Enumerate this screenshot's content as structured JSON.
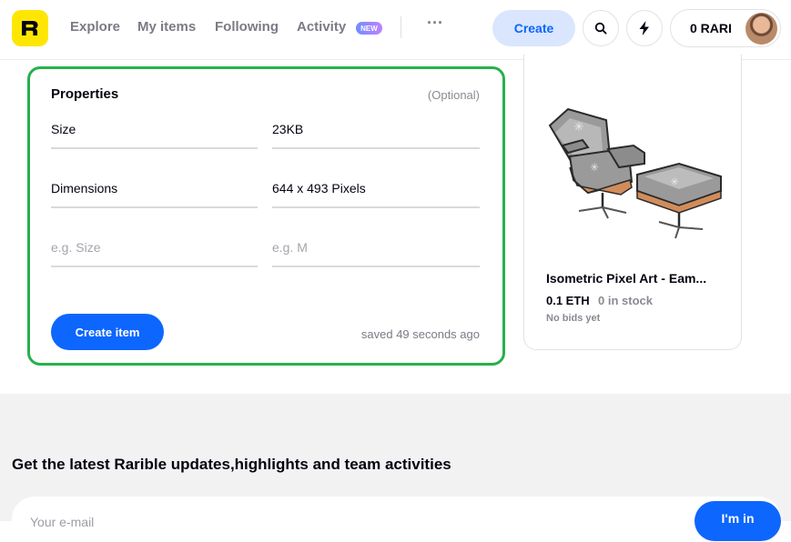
{
  "nav": {
    "items": [
      {
        "label": "Explore"
      },
      {
        "label": "My items"
      },
      {
        "label": "Following"
      },
      {
        "label": "Activity"
      }
    ],
    "new_badge": "NEW",
    "more_label": "···",
    "create_label": "Create",
    "wallet_label": "0 RARI"
  },
  "properties": {
    "title": "Properties",
    "optional_label": "(Optional)",
    "rows": [
      {
        "key": "Size",
        "value": "23KB"
      },
      {
        "key": "Dimensions",
        "value": "644 x 493 Pixels"
      }
    ],
    "key_placeholder": "e.g. Size",
    "value_placeholder": "e.g. M",
    "create_button": "Create item",
    "saved_status": "saved 49 seconds ago"
  },
  "preview": {
    "title": "Isometric Pixel Art - Eam...",
    "price": "0.1 ETH",
    "stock": "0 in stock",
    "bids": "No bids yet"
  },
  "footer": {
    "title": "Get the latest Rarible updates,highlights and team activities",
    "email_placeholder": "Your e-mail",
    "submit_label": "I'm in"
  },
  "colors": {
    "accent": "#0d66fe",
    "logo_bg": "#fee603",
    "highlight_border": "#26b14c"
  }
}
